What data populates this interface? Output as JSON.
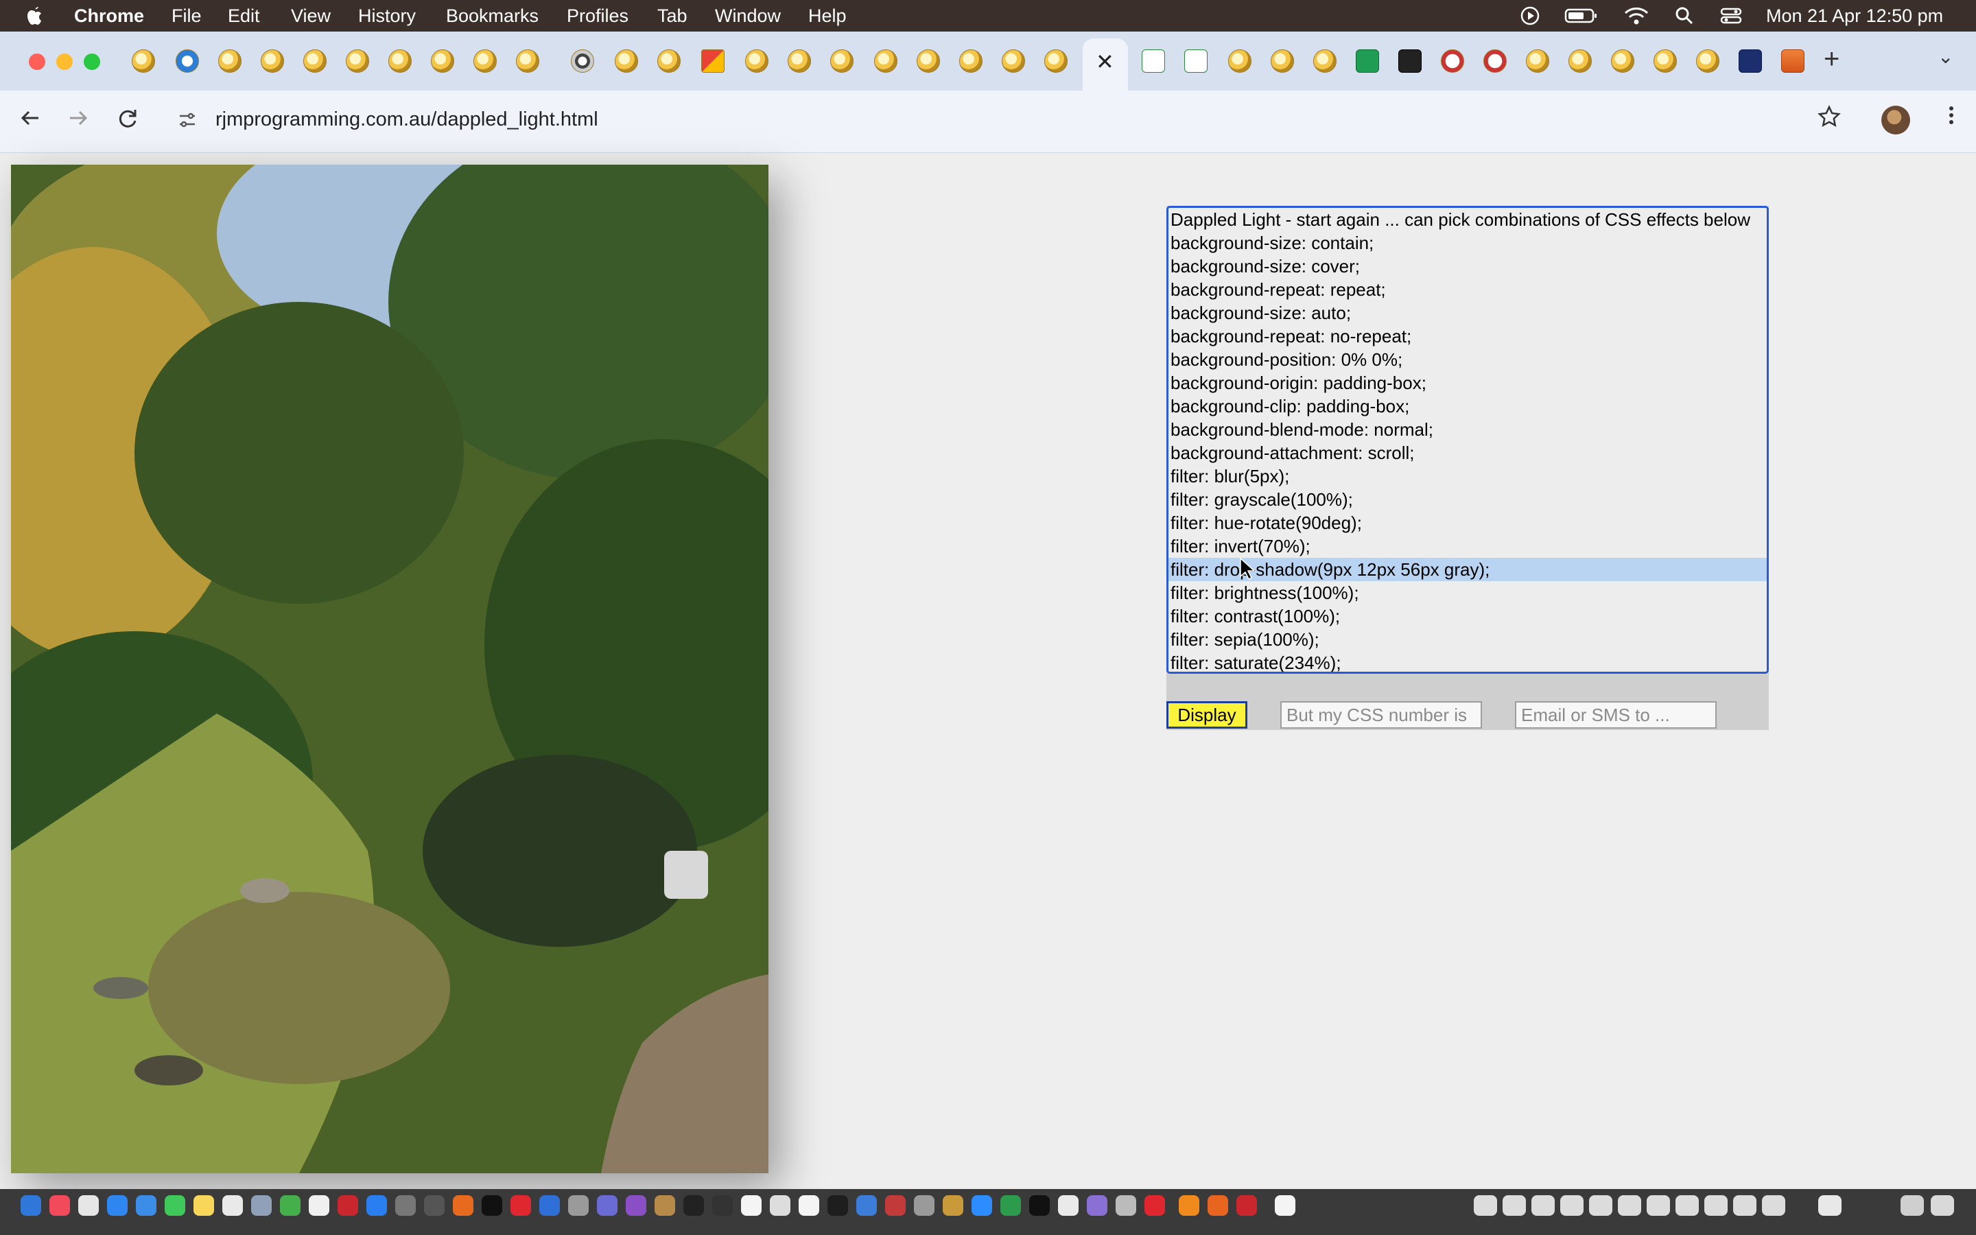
{
  "menubar": {
    "app": "Chrome",
    "items": [
      "File",
      "Edit",
      "View",
      "History",
      "Bookmarks",
      "Profiles",
      "Tab",
      "Window",
      "Help"
    ],
    "clock": "Mon 21 Apr  12:50 pm"
  },
  "tabs": {
    "close_glyph": "✕",
    "new_tab_glyph": "+",
    "menu_glyph": "⌄"
  },
  "toolbar": {
    "url": "rjmprogramming.com.au/dappled_light.html"
  },
  "effects": {
    "options": [
      "Dappled Light - start again ... can pick combinations of CSS effects below",
      "background-size: contain;",
      "background-size: cover;",
      "background-repeat: repeat;",
      "background-size: auto;",
      "background-repeat: no-repeat;",
      "background-position: 0% 0%;",
      "background-origin: padding-box;",
      "background-clip: padding-box;",
      "background-blend-mode: normal;",
      "background-attachment: scroll;",
      "filter: blur(5px);",
      "filter: grayscale(100%);",
      "filter: hue-rotate(90deg);",
      "filter: invert(70%);",
      "filter: drop-shadow(9px 12px 56px gray);",
      "filter: brightness(100%);",
      "filter: contrast(100%);",
      "filter: sepia(100%);",
      "filter: saturate(234%);"
    ],
    "selected_index": 15
  },
  "controls": {
    "display_label": "Display",
    "css_number_placeholder": "But my CSS number is",
    "email_placeholder": "Email or SMS to ..."
  },
  "colors": {
    "accent_blue": "#2a5bd7",
    "display_button": "#fbf33a",
    "selection": "#b9d4f3"
  }
}
